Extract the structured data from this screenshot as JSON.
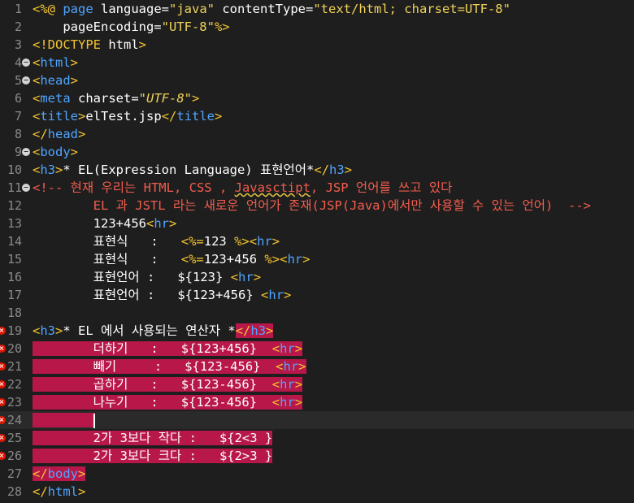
{
  "editor": {
    "file_title": "elTest.jsp",
    "lines": [
      {
        "n": "1",
        "marker": "",
        "sel": false,
        "tokens": [
          [
            "dir",
            "<%@"
          ],
          [
            "kw",
            " page"
          ],
          [
            "attr",
            " language="
          ],
          [
            "str",
            "\"java\""
          ],
          [
            "attr",
            " contentType="
          ],
          [
            "str",
            "\"text/html; charset=UTF-8\""
          ]
        ]
      },
      {
        "n": "2",
        "marker": "",
        "sel": false,
        "tokens": [
          [
            "attr",
            "    pageEncoding="
          ],
          [
            "str",
            "\"UTF-8\""
          ],
          [
            "dir",
            "%>"
          ]
        ]
      },
      {
        "n": "3",
        "marker": "",
        "sel": false,
        "tokens": [
          [
            "dir",
            "<!DOCTYPE"
          ],
          [
            "txt",
            " html"
          ],
          [
            "dir",
            ">"
          ]
        ]
      },
      {
        "n": "4",
        "marker": "fold",
        "sel": false,
        "tokens": [
          [
            "dir",
            "<"
          ],
          [
            "kw",
            "html"
          ],
          [
            "dir",
            ">"
          ]
        ]
      },
      {
        "n": "5",
        "marker": "fold",
        "sel": false,
        "tokens": [
          [
            "dir",
            "<"
          ],
          [
            "kw",
            "head"
          ],
          [
            "dir",
            ">"
          ]
        ]
      },
      {
        "n": "6",
        "marker": "",
        "sel": false,
        "tokens": [
          [
            "dir",
            "<"
          ],
          [
            "kw",
            "meta"
          ],
          [
            "attr",
            " charset="
          ],
          [
            "str-i",
            "\"UTF-8\""
          ],
          [
            "dir",
            ">"
          ]
        ]
      },
      {
        "n": "7",
        "marker": "",
        "sel": false,
        "tokens": [
          [
            "dir",
            "<"
          ],
          [
            "kw",
            "title"
          ],
          [
            "dir",
            ">"
          ],
          [
            "txt",
            "elTest.jsp"
          ],
          [
            "dir",
            "</"
          ],
          [
            "kw",
            "title"
          ],
          [
            "dir",
            ">"
          ]
        ]
      },
      {
        "n": "8",
        "marker": "",
        "sel": false,
        "tokens": [
          [
            "dir",
            "</"
          ],
          [
            "kw",
            "head"
          ],
          [
            "dir",
            ">"
          ]
        ]
      },
      {
        "n": "9",
        "marker": "fold",
        "sel": false,
        "tokens": [
          [
            "dir",
            "<"
          ],
          [
            "kw",
            "body"
          ],
          [
            "dir",
            ">"
          ]
        ]
      },
      {
        "n": "10",
        "marker": "",
        "sel": false,
        "tokens": [
          [
            "dir",
            "<"
          ],
          [
            "kw",
            "h3"
          ],
          [
            "dir",
            ">"
          ],
          [
            "txt",
            "* EL(Expression Language) 표현언어*"
          ],
          [
            "dir",
            "</"
          ],
          [
            "kw",
            "h3"
          ],
          [
            "dir",
            ">"
          ]
        ]
      },
      {
        "n": "11",
        "marker": "fold",
        "sel": false,
        "tokens": [
          [
            "cmt",
            "<!-- 현재 우리는 HTML, CSS , "
          ],
          [
            "cmt-warn",
            "Javasctipt"
          ],
          [
            "cmt",
            ", JSP 언어를 쓰고 있다"
          ]
        ]
      },
      {
        "n": "12",
        "marker": "",
        "sel": false,
        "tokens": [
          [
            "cmt",
            "        EL 과 JSTL 라는 새로운 언어가 존재(JSP(Java)에서만 사용할 수 있는 언어)  -->"
          ]
        ]
      },
      {
        "n": "13",
        "marker": "",
        "sel": false,
        "tokens": [
          [
            "txt",
            "        123+456"
          ],
          [
            "dir",
            "<"
          ],
          [
            "kw",
            "hr"
          ],
          [
            "dir",
            ">"
          ]
        ]
      },
      {
        "n": "14",
        "marker": "",
        "sel": false,
        "tokens": [
          [
            "txt",
            "        표현식   :   "
          ],
          [
            "dir",
            "<%="
          ],
          [
            "txt",
            "123 "
          ],
          [
            "dir",
            "%>"
          ],
          [
            "dir",
            "<"
          ],
          [
            "kw",
            "hr"
          ],
          [
            "dir",
            ">"
          ]
        ]
      },
      {
        "n": "15",
        "marker": "",
        "sel": false,
        "tokens": [
          [
            "txt",
            "        표현식   :   "
          ],
          [
            "dir",
            "<%="
          ],
          [
            "txt",
            "123+456 "
          ],
          [
            "dir",
            "%>"
          ],
          [
            "dir",
            "<"
          ],
          [
            "kw",
            "hr"
          ],
          [
            "dir",
            ">"
          ]
        ]
      },
      {
        "n": "16",
        "marker": "",
        "sel": false,
        "tokens": [
          [
            "txt",
            "        표현언어 :   ${123} "
          ],
          [
            "dir",
            "<"
          ],
          [
            "kw",
            "hr"
          ],
          [
            "dir",
            ">"
          ]
        ]
      },
      {
        "n": "17",
        "marker": "",
        "sel": false,
        "tokens": [
          [
            "txt",
            "        표현언어 :   ${123+456} "
          ],
          [
            "dir",
            "<"
          ],
          [
            "kw",
            "hr"
          ],
          [
            "dir",
            ">"
          ]
        ]
      },
      {
        "n": "18",
        "marker": "",
        "sel": false,
        "tokens": []
      },
      {
        "n": "19",
        "marker": "error",
        "sel": false,
        "pre": "        ",
        "tokens": [
          [
            "dir",
            "<"
          ],
          [
            "kw",
            "h3"
          ],
          [
            "dir",
            ">"
          ],
          [
            "txt",
            "* EL 에서 사용되는 연산자 *"
          ],
          [
            "sel-dir",
            "</"
          ],
          [
            "sel-kw",
            "h3"
          ],
          [
            "sel-dir",
            ">"
          ]
        ]
      },
      {
        "n": "20",
        "marker": "error",
        "sel": true,
        "tokens": [
          [
            "txt",
            "        더하기   :   ${123+456}  "
          ],
          [
            "dir",
            "<"
          ],
          [
            "kw",
            "hr"
          ],
          [
            "dir",
            ">"
          ]
        ]
      },
      {
        "n": "21",
        "marker": "error",
        "sel": true,
        "tokens": [
          [
            "txt",
            "        빼기     :   ${123-456}  "
          ],
          [
            "dir",
            "<"
          ],
          [
            "kw",
            "hr"
          ],
          [
            "dir",
            ">"
          ]
        ]
      },
      {
        "n": "22",
        "marker": "error",
        "sel": true,
        "tokens": [
          [
            "txt",
            "        곱하기   :   ${123-456}  "
          ],
          [
            "dir",
            "<"
          ],
          [
            "kw",
            "hr"
          ],
          [
            "dir",
            ">"
          ]
        ]
      },
      {
        "n": "23",
        "marker": "error",
        "sel": true,
        "tokens": [
          [
            "txt",
            "        나누기   :   ${123-456}  "
          ],
          [
            "dir",
            "<"
          ],
          [
            "kw",
            "hr"
          ],
          [
            "dir",
            ">"
          ]
        ]
      },
      {
        "n": "24",
        "marker": "error",
        "sel": true,
        "current": true,
        "tokens": [
          [
            "txt",
            "        "
          ]
        ]
      },
      {
        "n": "25",
        "marker": "error",
        "sel": true,
        "tokens": [
          [
            "txt",
            "        2가 3보다 작다 :   ${2<3 }"
          ]
        ]
      },
      {
        "n": "26",
        "marker": "error",
        "sel": true,
        "tokens": [
          [
            "txt",
            "        2가 3보다 크다 :   ${2>3 }"
          ]
        ]
      },
      {
        "n": "27",
        "marker": "",
        "sel": true,
        "tokens": [
          [
            "dir",
            "</"
          ],
          [
            "kw",
            "body"
          ],
          [
            "dir",
            ">"
          ]
        ]
      },
      {
        "n": "28",
        "marker": "",
        "sel": false,
        "tokens": [
          [
            "dir",
            "</"
          ],
          [
            "kw",
            "html"
          ],
          [
            "dir",
            ">"
          ]
        ]
      }
    ]
  },
  "colors": {
    "background": "#1e1e1e",
    "selection": "#b8174a",
    "keyword": "#4fa5ff",
    "directive": "#f4c430",
    "string": "#f0d35a",
    "comment": "#f25d4e",
    "error_marker": "#e51400"
  },
  "icons": {
    "fold": "fold-collapse-icon",
    "error": "error-x-icon"
  }
}
